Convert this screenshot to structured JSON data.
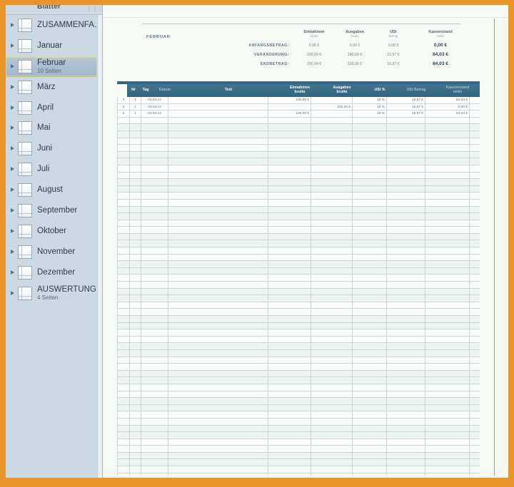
{
  "window": {
    "chrome_color": "#e8952a"
  },
  "sidebar": {
    "title": "Blätter",
    "collapse_icon": "resize-handle-icon",
    "items": [
      {
        "label": "ZUSAMMENFA…",
        "sub": ""
      },
      {
        "label": "Januar",
        "sub": ""
      },
      {
        "label": "Februar",
        "sub": "10 Seiten",
        "selected": true
      },
      {
        "label": "März",
        "sub": ""
      },
      {
        "label": "April",
        "sub": ""
      },
      {
        "label": "Mai",
        "sub": ""
      },
      {
        "label": "Juni",
        "sub": ""
      },
      {
        "label": "Juli",
        "sub": ""
      },
      {
        "label": "August",
        "sub": ""
      },
      {
        "label": "September",
        "sub": ""
      },
      {
        "label": "Oktober",
        "sub": ""
      },
      {
        "label": "November",
        "sub": ""
      },
      {
        "label": "Dezember",
        "sub": ""
      },
      {
        "label": "AUSWERTUNG",
        "sub": "4 Seiten"
      }
    ]
  },
  "sheet": {
    "month_label": "FEBRUAR",
    "summary": {
      "columns": [
        {
          "title": "Einnahmen",
          "sub": "brutto"
        },
        {
          "title": "Ausgaben",
          "sub": "brutto"
        },
        {
          "title": "USt",
          "sub": "Betrag"
        },
        {
          "title": "Kassenstand",
          "sub": "netto"
        }
      ],
      "rows": [
        {
          "label": "ANFANGSBETRAG:",
          "einnahmen": "0,00 €",
          "ausgaben": "0,00 €",
          "ust": "0,00 €",
          "kassenstand": "0,00 €"
        },
        {
          "label": "VERÄNDERUNG:",
          "einnahmen": "200,00 €",
          "ausgaben": "100,00 €",
          "ust": "15,97 €",
          "kassenstand": "84,03 €"
        },
        {
          "label": "ENDBETRAG:",
          "einnahmen": "200,00 €",
          "ausgaben": "100,00 €",
          "ust": "15,97 €",
          "kassenstand": "84,03 €"
        }
      ]
    },
    "table": {
      "headers": [
        {
          "title": "Nr",
          "sub": "",
          "dim": false
        },
        {
          "title": "Tag",
          "sub": "",
          "dim": false
        },
        {
          "title": "Datum",
          "sub": "",
          "dim": true
        },
        {
          "title": "Text",
          "sub": "",
          "dim": false
        },
        {
          "title": "Einnahmen",
          "sub": "brutto",
          "dim": false
        },
        {
          "title": "Ausgaben",
          "sub": "brutto",
          "dim": false
        },
        {
          "title": "USt %",
          "sub": "",
          "dim": false
        },
        {
          "title": "USt Betrag",
          "sub": "",
          "dim": true
        },
        {
          "title": "Kassenstand",
          "sub": "netto",
          "dim": true
        }
      ],
      "rows": [
        {
          "nr": "4",
          "tag": "1",
          "datum": "02.02.13",
          "text": "",
          "einnahmen": "100,00 €",
          "ausgaben": "",
          "ust_pct": "19 %",
          "ust_betrag": "15,97 €",
          "kassenstand": "84,03 €"
        },
        {
          "nr": "5",
          "tag": "1",
          "datum": "03.02.13",
          "text": "",
          "einnahmen": "",
          "ausgaben": "100,00 €",
          "ust_pct": "19 %",
          "ust_betrag": "15,97 €",
          "kassenstand": "0,00 €"
        },
        {
          "nr": "6",
          "tag": "1",
          "datum": "03.02.13",
          "text": "",
          "einnahmen": "100,00 €",
          "ausgaben": "",
          "ust_pct": "19 %",
          "ust_betrag": "15,97 €",
          "kassenstand": "84,03 €"
        }
      ],
      "empty_row_count": 54
    }
  }
}
